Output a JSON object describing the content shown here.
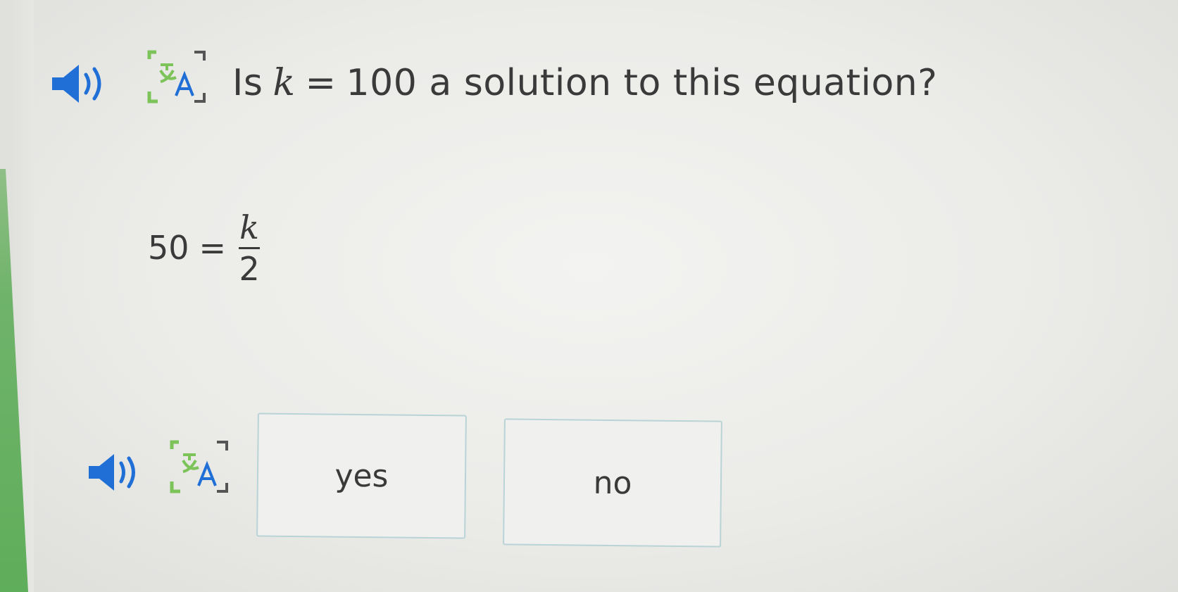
{
  "question": {
    "prefix": "Is",
    "variable": "k",
    "equals": "=",
    "value": "100",
    "suffix": "a solution to this equation?"
  },
  "equation": {
    "lhs": "50",
    "relation": "=",
    "numerator": "k",
    "denominator": "2"
  },
  "choices": [
    {
      "label": "yes"
    },
    {
      "label": "no"
    }
  ],
  "icons": {
    "audio": "speaker-icon",
    "translate": "translate-icon"
  },
  "colors": {
    "green_strip": "#6fb36a",
    "translate_icon": "#7cc35a",
    "speaker_icon": "#1f6fd6",
    "choice_border": "#b9d3d6"
  }
}
